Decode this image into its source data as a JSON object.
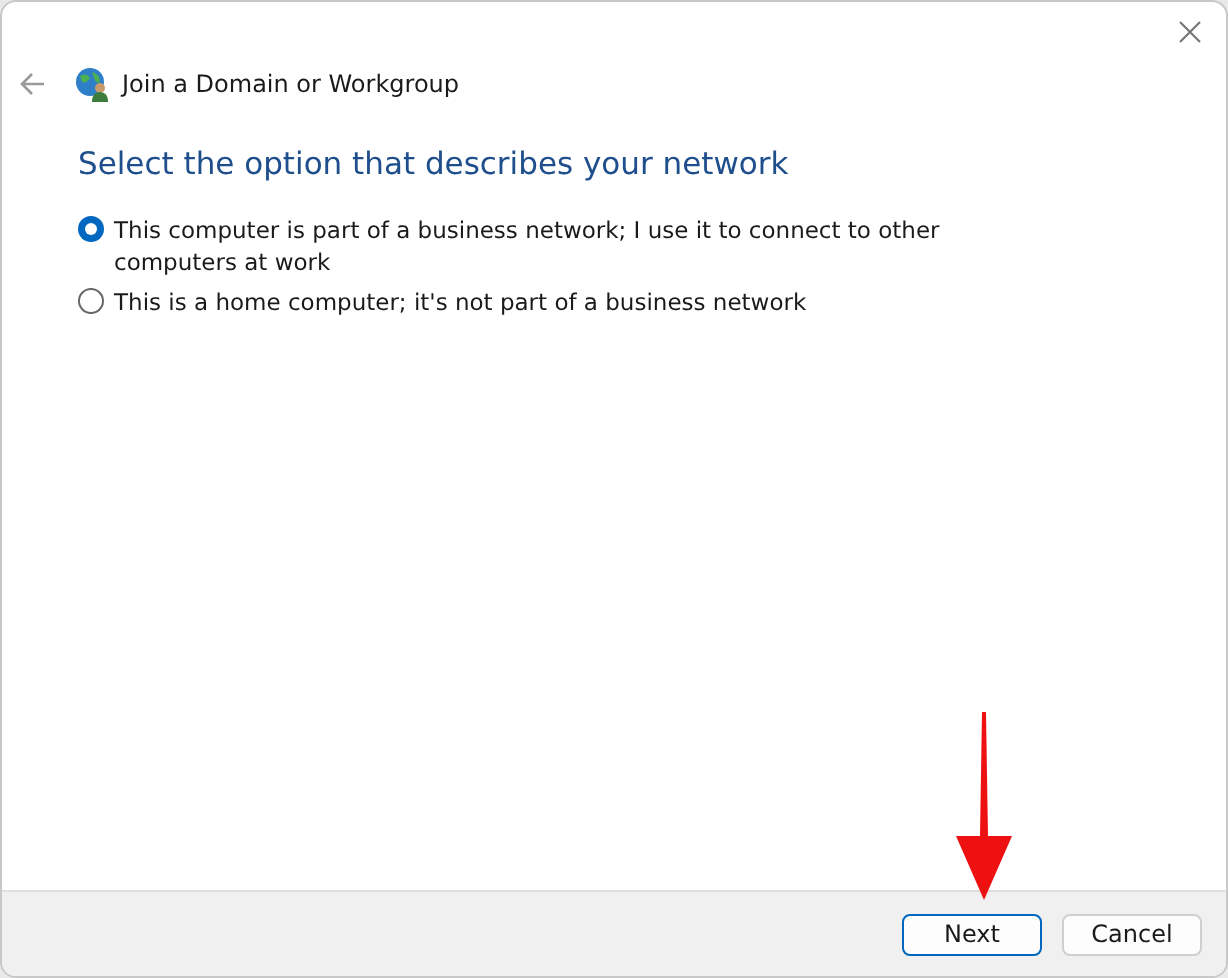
{
  "window": {
    "title": "Join a Domain or Workgroup"
  },
  "heading": "Select the option that describes your network",
  "options": [
    {
      "label": "This computer is part of a business network; I use it to connect to other computers at work",
      "selected": true
    },
    {
      "label": "This is a home computer; it's not part of a business network",
      "selected": false
    }
  ],
  "buttons": [
    {
      "label": "Next",
      "kind": "default"
    },
    {
      "label": "Cancel",
      "kind": "normal"
    }
  ]
}
